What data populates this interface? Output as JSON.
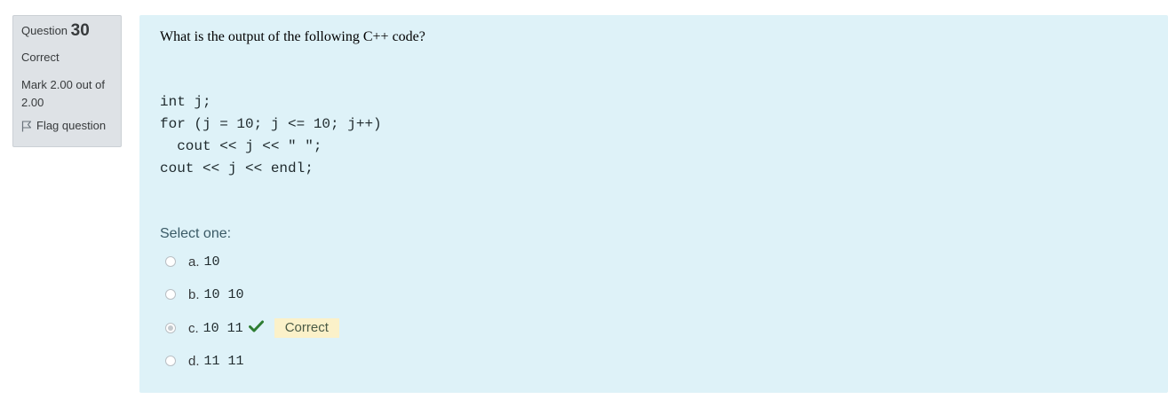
{
  "info": {
    "question_word": "Question",
    "question_number": "30",
    "state": "Correct",
    "grade": "Mark 2.00 out of 2.00",
    "flag_label": "Flag question"
  },
  "question": {
    "text": "What is the output of the following C++ code?",
    "code_lines": [
      "int j;",
      "for (j = 10; j <= 10; j++)",
      "  cout << j << \" \";",
      "cout << j << endl;"
    ],
    "prompt": "Select one:",
    "answers": [
      {
        "letter": "a.",
        "text": "10",
        "selected": false
      },
      {
        "letter": "b.",
        "text": "10 10",
        "selected": false
      },
      {
        "letter": "c.",
        "text": "10 11",
        "selected": true,
        "feedback": "Correct"
      },
      {
        "letter": "d.",
        "text": "11 11",
        "selected": false
      }
    ]
  },
  "colors": {
    "correct_check": "#2e7d32",
    "content_background": "#def2f8",
    "info_background": "#dee2e6"
  }
}
